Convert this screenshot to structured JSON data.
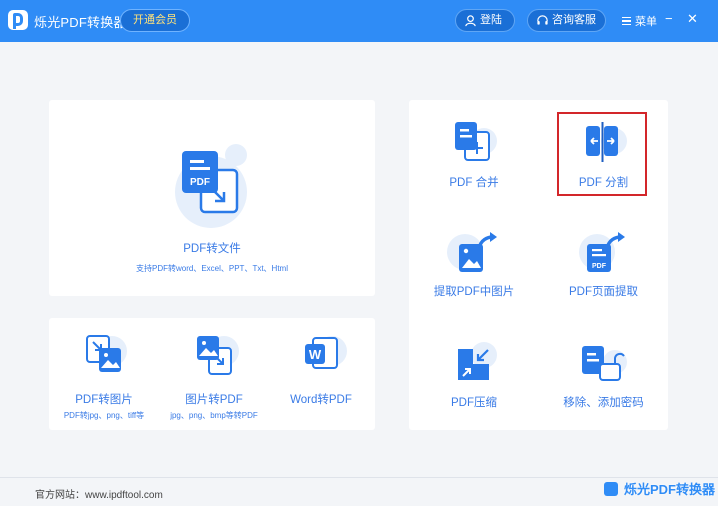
{
  "titlebar": {
    "app_title": "烁光PDF转换器",
    "vip_label": "开通会员",
    "login_label": "登陆",
    "service_label": "咨询客服",
    "menu_label": "菜单",
    "minimize_glyph": "−",
    "close_glyph": "✕"
  },
  "main_tool": {
    "label": "PDF转文件",
    "sub": "支持PDF转word、Excel、PPT、Txt、Html",
    "icon_text": "PDF"
  },
  "bottom_tools": [
    {
      "label": "PDF转图片",
      "sub": "PDF转jpg、png、tiff等"
    },
    {
      "label": "图片转PDF",
      "sub": "jpg、png、bmp等转PDF"
    },
    {
      "label": "Word转PDF",
      "sub": "",
      "icon_text": "W"
    }
  ],
  "right_tools": [
    {
      "label": "PDF 合并"
    },
    {
      "label": "PDF 分割"
    },
    {
      "label": "提取PDF中图片"
    },
    {
      "label": "PDF页面提取",
      "icon_text": "PDF"
    },
    {
      "label": "PDF压缩"
    },
    {
      "label": "移除、添加密码"
    }
  ],
  "footer": {
    "site": "官方网站：www.ipdftool.com",
    "watermark": "烁光PDF转换器"
  },
  "colors": {
    "brand": "#2f8cf6",
    "label": "#3a7be6",
    "highlight": "#d3262a"
  },
  "icons": [
    "logo-icon",
    "user-icon",
    "headset-icon",
    "menu-icon",
    "pdf-to-file-icon",
    "pdf-to-image-icon",
    "image-to-pdf-icon",
    "word-to-pdf-icon",
    "merge-icon",
    "split-icon",
    "extract-image-icon",
    "page-extract-icon",
    "compress-icon",
    "password-icon"
  ]
}
